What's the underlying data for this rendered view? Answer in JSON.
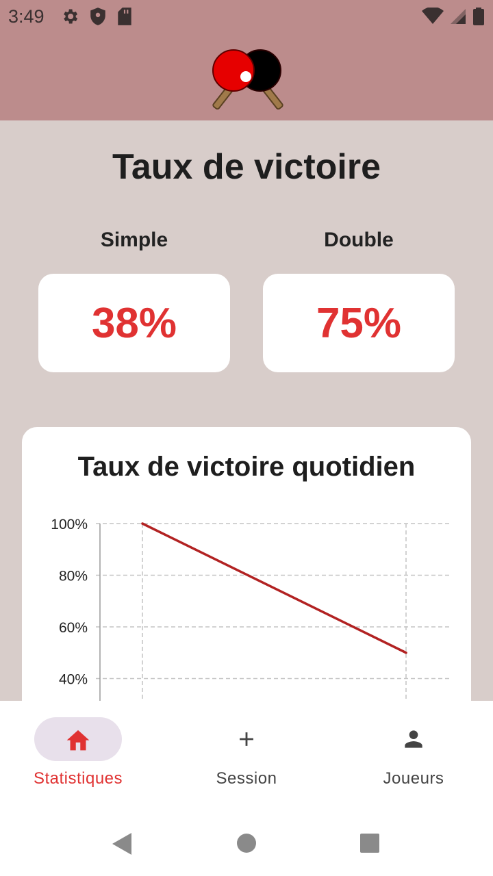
{
  "status_bar": {
    "time": "3:49"
  },
  "header": {
    "logo_icon": "ping-pong-paddles-icon"
  },
  "main": {
    "title": "Taux de victoire",
    "stats": [
      {
        "label": "Simple",
        "value": "38%"
      },
      {
        "label": "Double",
        "value": "75%"
      }
    ],
    "accent_color": "#e03232"
  },
  "chart_data": {
    "type": "line",
    "title": "Taux de victoire quotidien",
    "y_tick_labels": [
      "100%",
      "80%",
      "60%",
      "40%"
    ],
    "ylim": [
      40,
      100
    ],
    "grid": true,
    "series": [
      {
        "values": [
          100,
          50
        ],
        "color": "#b22222"
      }
    ]
  },
  "bottom_nav": {
    "items": [
      {
        "label": "Statistiques",
        "icon": "home-icon",
        "active": true
      },
      {
        "label": "Session",
        "icon": "plus-icon",
        "active": false
      },
      {
        "label": "Joueurs",
        "icon": "person-icon",
        "active": false
      }
    ]
  }
}
